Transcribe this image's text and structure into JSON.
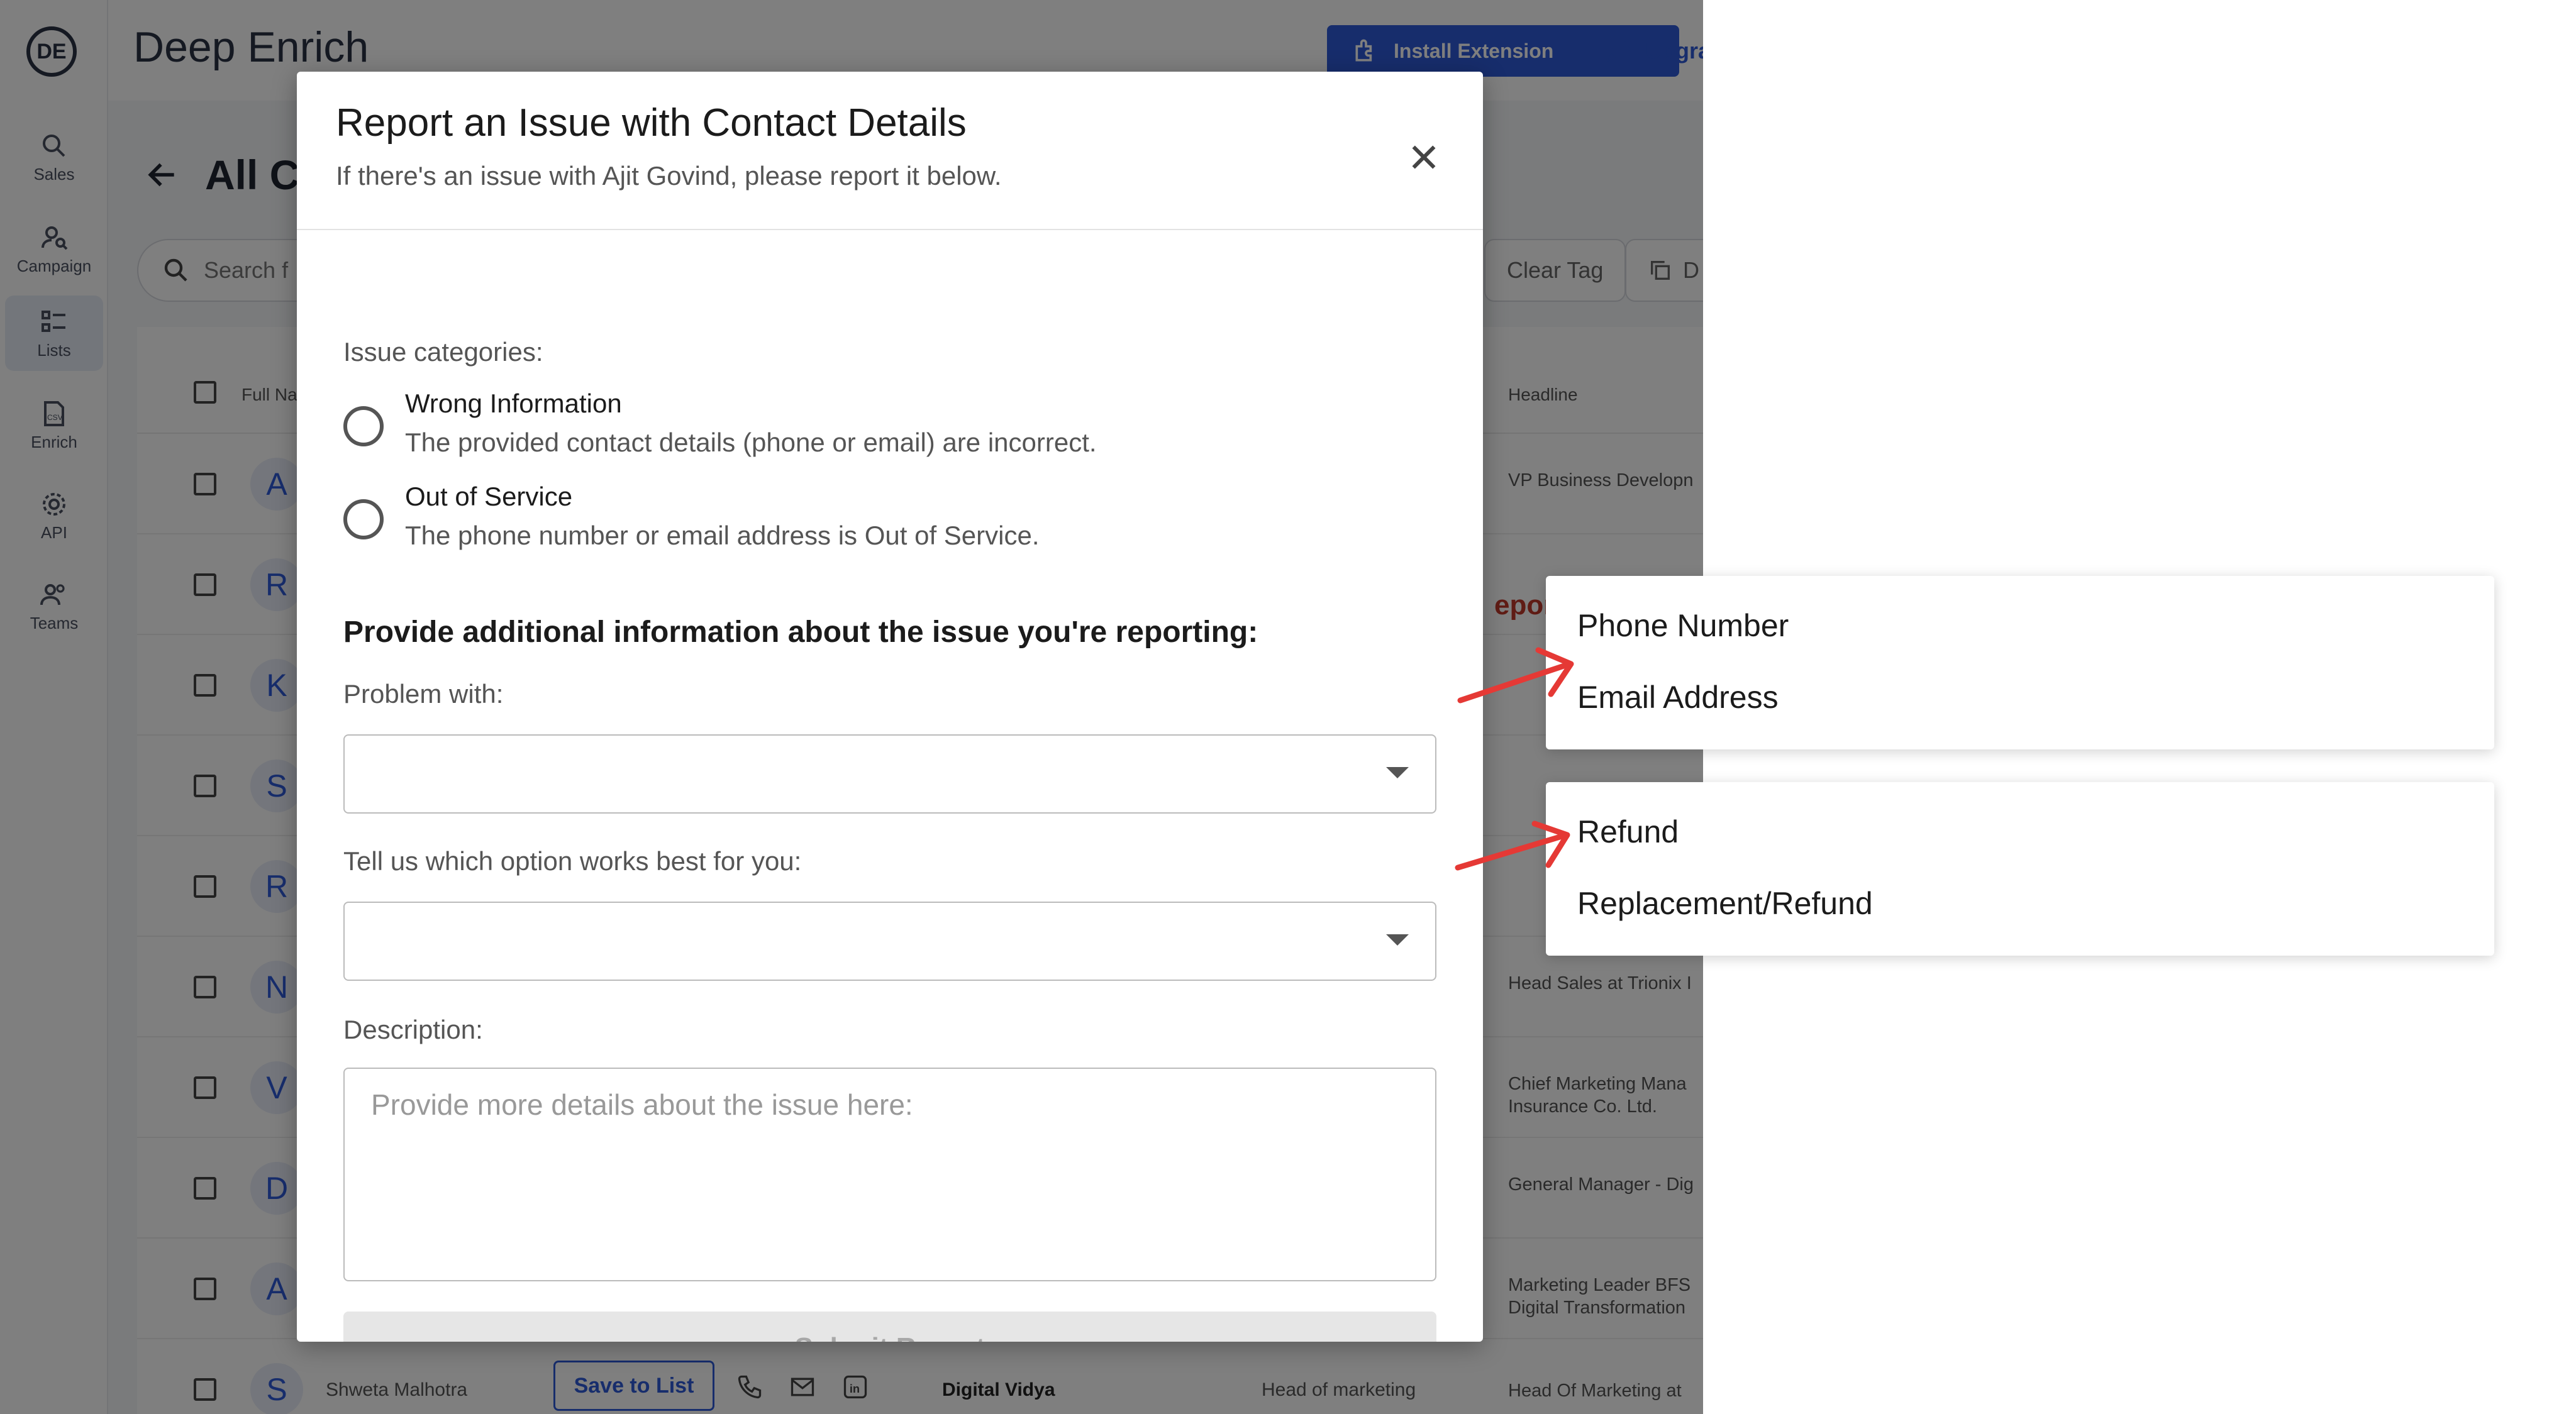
{
  "app": {
    "brand": "Deep Enrich",
    "install_label": "Install Extension",
    "upgrade_label": "Upgra",
    "page_title": "All Co",
    "search_placeholder": "Search f",
    "clear_tag_label": "Clear Tag",
    "extra_tool_label": "D",
    "report_peek": "eport"
  },
  "sidebar": {
    "items": [
      {
        "label": "Sales",
        "icon": "search-icon"
      },
      {
        "label": "Campaign",
        "icon": "campaign-icon"
      },
      {
        "label": "Lists",
        "icon": "list-icon"
      },
      {
        "label": "Enrich",
        "icon": "csv-file-icon"
      },
      {
        "label": "API",
        "icon": "gear-icon"
      },
      {
        "label": "Teams",
        "icon": "people-icon"
      }
    ]
  },
  "table": {
    "col_full_name": "Full Na",
    "col_headline": "Headline",
    "rows": [
      {
        "initial": "A",
        "headline": "VP Business Developn"
      },
      {
        "initial": "R",
        "headline": ""
      },
      {
        "initial": "K",
        "headline": ""
      },
      {
        "initial": "S",
        "headline": ""
      },
      {
        "initial": "R",
        "headline": ""
      },
      {
        "initial": "N",
        "headline": "Head Sales at Trionix I"
      },
      {
        "initial": "V",
        "headline": "Chief Marketing Mana\nInsurance Co. Ltd."
      },
      {
        "initial": "D",
        "headline": "General Manager - Dig"
      },
      {
        "initial": "A",
        "headline": "Marketing Leader BFS\nDigital Transformation"
      }
    ],
    "last_row": {
      "initial": "S",
      "name": "Shweta Malhotra",
      "save_label": "Save to List",
      "company": "Digital Vidya",
      "title": "Head of marketing",
      "headline": "Head Of Marketing at"
    }
  },
  "modal": {
    "title": "Report an Issue with Contact Details",
    "subtitle": "If there's an issue with Ajit Govind, please report it below.",
    "categories_label": "Issue categories:",
    "options": [
      {
        "title": "Wrong Information",
        "desc": "The provided contact details (phone or email) are incorrect."
      },
      {
        "title": "Out of Service",
        "desc": "The phone number or email address is Out of Service."
      }
    ],
    "info_heading": "Provide additional information about the issue you're reporting:",
    "problem_label": "Problem with:",
    "problem_value": "",
    "option_label": "Tell us which option works best for you:",
    "option_value": "",
    "description_label": "Description:",
    "description_placeholder": "Provide more details about the issue here:",
    "submit_label": "Submit Report"
  },
  "callouts": {
    "problem_options": [
      "Phone Number",
      "Email Address"
    ],
    "resolution_options": [
      "Refund",
      "Replacement/Refund"
    ]
  },
  "colors": {
    "accent": "#2e5bd8",
    "arrow": "#e53935",
    "overlay": "rgba(0,0,0,0.5)"
  }
}
